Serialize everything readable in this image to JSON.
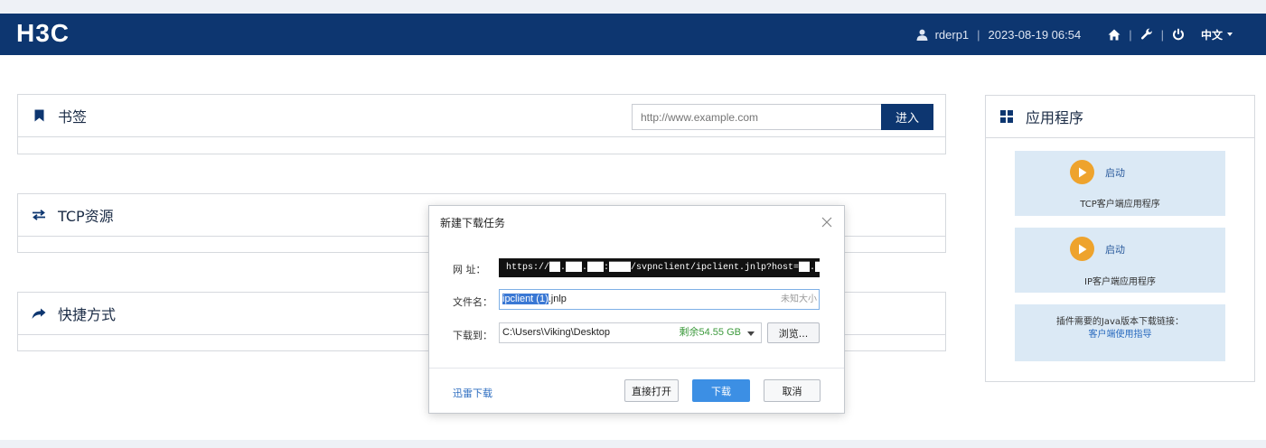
{
  "header": {
    "logo": "H3C",
    "user": "rderp1",
    "timestamp": "2023-08-19 06:54",
    "sep": "|",
    "language": "中文"
  },
  "bookmarks": {
    "title": "书签",
    "url_placeholder": "http://www.example.com",
    "go_label": "进入"
  },
  "tcp_resources": {
    "title": "TCP资源"
  },
  "shortcuts": {
    "title": "快捷方式"
  },
  "apps": {
    "title": "应用程序",
    "tcp_launch_label": "启动",
    "tcp_app_name": "TCP客户端应用程序",
    "ip_launch_label": "启动",
    "ip_app_name": "IP客户端应用程序",
    "java_hint": "插件需要的Java版本下载链接：",
    "guide_link": "客户端使用指导"
  },
  "download_dialog": {
    "title": "新建下载任务",
    "url_label": "网 址：",
    "url_value": "https://██.███.███:████/svpnclient/ipclient.jnlp?host=██.███.██.███",
    "filename_label": "文件名：",
    "filename_selected": "ipclient (1)",
    "filename_ext": ".jnlp",
    "size_text": "未知大小",
    "saveto_label": "下载到：",
    "saveto_path": "C:\\Users\\Viking\\Desktop",
    "free_space": "剩余54.55 GB",
    "browse_label": "浏览...",
    "thunder_link": "迅雷下载",
    "open_label": "直接打开",
    "download_label": "下载",
    "cancel_label": "取消"
  },
  "colors": {
    "header_bg": "#0d3670",
    "accent": "#3c8fe4",
    "app_card_bg": "#dbe9f5",
    "play_icon": "#eea32d"
  }
}
